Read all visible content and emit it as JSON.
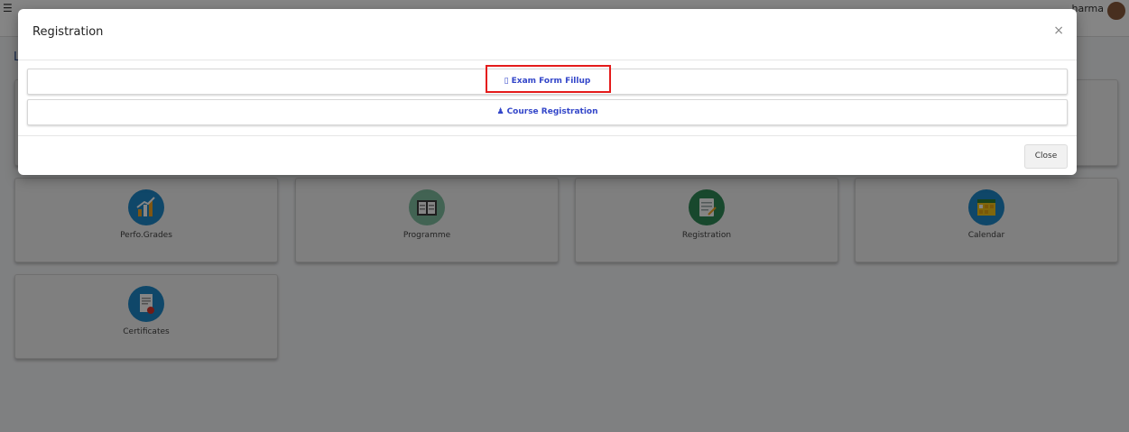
{
  "topbar": {
    "user_name": "harma",
    "menu_icon": "hamburger-icon"
  },
  "page": {
    "heading_letter": "L"
  },
  "tiles": [
    {
      "label": "Perfo.Grades",
      "icon": "bar-chart-icon",
      "color": "#1e88c9"
    },
    {
      "label": "Programme",
      "icon": "book-icon",
      "color": "#7fbfa0"
    },
    {
      "label": "Registration",
      "icon": "registration-form-icon",
      "color": "#2e8b57"
    },
    {
      "label": "Calendar",
      "icon": "calendar-icon",
      "color": "#1e88c9"
    },
    {
      "label": "Certificates",
      "icon": "certificate-icon",
      "color": "#1e88c9"
    }
  ],
  "modal": {
    "title": "Registration",
    "close_glyph": "×",
    "options": [
      {
        "label": "Exam Form Fillup",
        "glyph": "▯",
        "icon": "form-icon"
      },
      {
        "label": "Course Registration",
        "glyph": "♟",
        "icon": "users-icon"
      }
    ],
    "close_label": "Close",
    "accent_color": "#3346c9",
    "highlight_color": "#e41b1b"
  }
}
